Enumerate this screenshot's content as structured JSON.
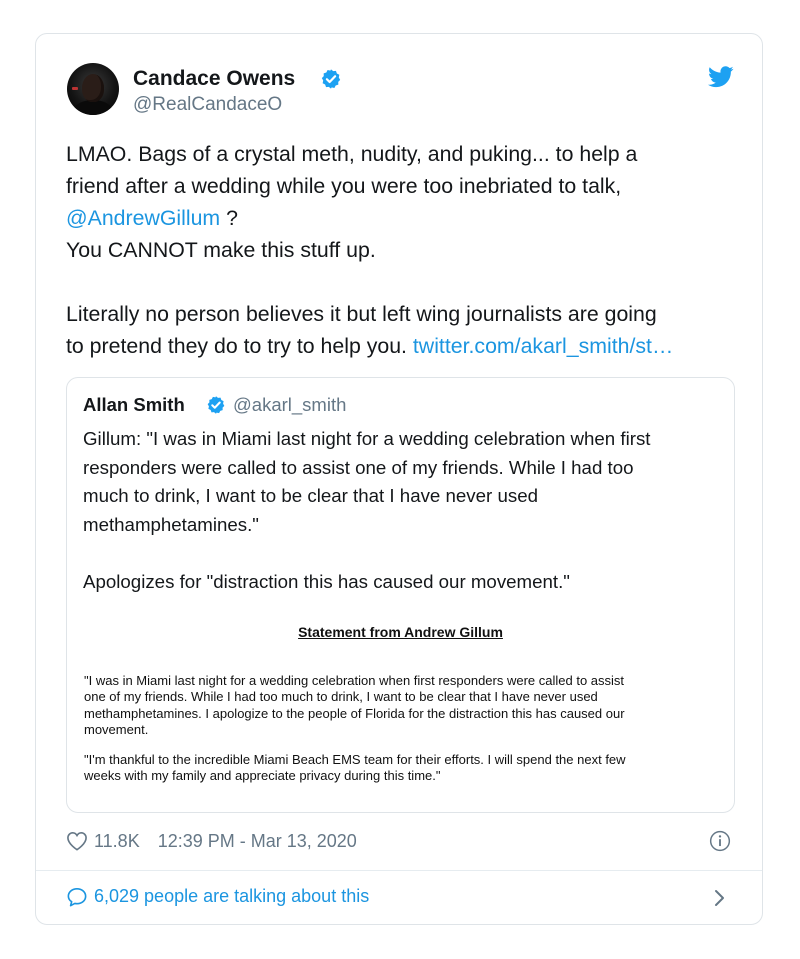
{
  "tweet": {
    "author_name": "Candace Owens",
    "author_handle": "@RealCandaceO",
    "lines": [
      "LMAO. Bags of a crystal meth, nudity, and puking... to help a",
      "friend after a wedding while you were too inebriated to talk,"
    ],
    "mention": "@AndrewGillum",
    "mention_suffix": " ?",
    "line4": "You CANNOT make this stuff up.",
    "line5": "Literally no person believes it but left wing journalists are going",
    "line6": "to pretend they do to try to help you. ",
    "link": "twitter.com/akarl_smith/st…",
    "likes": "11.8K",
    "timestamp": "12:39 PM - Mar 13, 2020",
    "talking": "6,029 people are talking about this"
  },
  "quote": {
    "author_name": "Allan Smith",
    "author_handle": "@akarl_smith",
    "lines": [
      "Gillum: \"I was in Miami last night for a wedding celebration when first",
      "responders were called to assist one of my friends. While I had too",
      "much to drink, I want to be clear that I have never used",
      "methamphetamines.\""
    ],
    "line5": "Apologizes for \"distraction this has caused our movement.\"",
    "statement_title": "Statement from Andrew Gillum",
    "statement_p1": [
      "\"I was in Miami last night for a wedding celebration when first responders were called to assist",
      "one of my friends. While I had too much to drink, I want to be clear that I have never used",
      "methamphetamines. I apologize to the people of Florida for the distraction this has caused our",
      "movement."
    ],
    "statement_p2": [
      "\"I'm thankful to the incredible Miami Beach EMS team for their efforts.  I will spend the next few",
      "weeks with my family and appreciate privacy during this time.\""
    ]
  },
  "icons": {
    "verified": "verified-badge-icon",
    "bird": "twitter-bird-icon",
    "heart": "heart-icon",
    "info": "info-icon",
    "comment": "comment-icon",
    "chevron": "chevron-right-icon"
  },
  "colors": {
    "link": "#1b95e0",
    "muted": "#657786",
    "text": "#14171a"
  }
}
